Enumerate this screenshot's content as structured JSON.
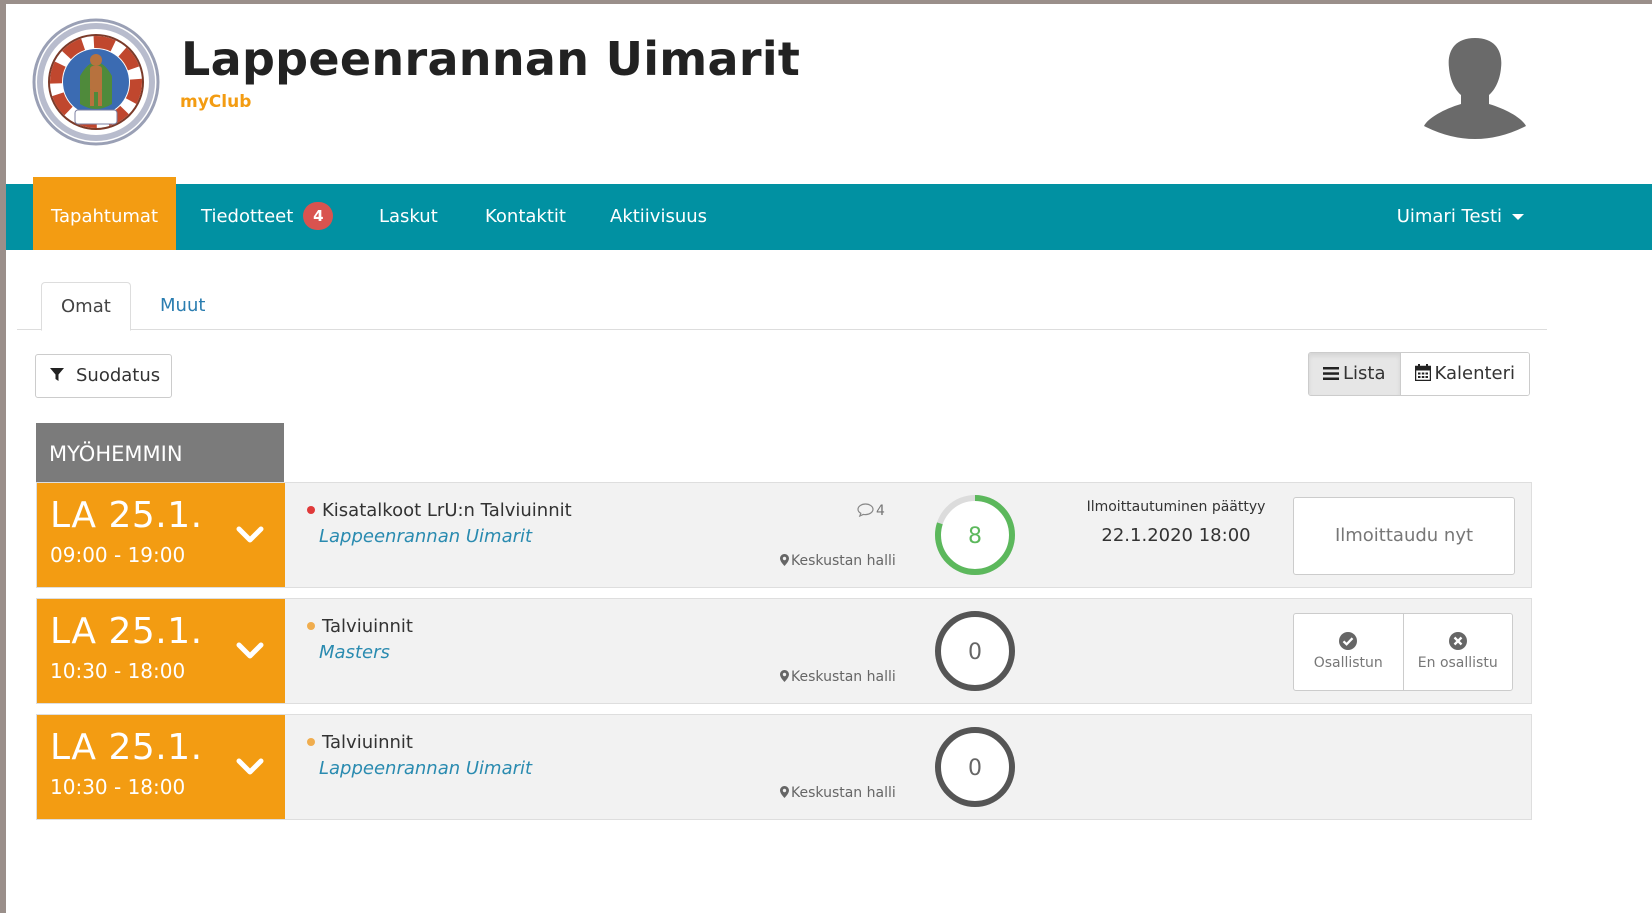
{
  "header": {
    "club_name": "Lappeenrannan Uimarit",
    "subtitle": "myClub",
    "logo_icon": "club-logo-icon",
    "avatar_icon": "user-silhouette-icon"
  },
  "nav": {
    "items": [
      {
        "label": "Tapahtumat",
        "active": true
      },
      {
        "label": "Tiedotteet",
        "badge": "4"
      },
      {
        "label": "Laskut"
      },
      {
        "label": "Kontaktit"
      },
      {
        "label": "Aktiivisuus"
      }
    ],
    "user": "Uimari Testi"
  },
  "tabs": [
    "Omat",
    "Muut"
  ],
  "toolbar": {
    "filter_label": "Suodatus",
    "view_list": "Lista",
    "view_calendar": "Kalenteri"
  },
  "section_label": "MYÖHEMMIN",
  "events": [
    {
      "day": "LA 25.1.",
      "time": "09:00 - 19:00",
      "title": "Kisatalkoot LrU:n Talviuinnit",
      "dot_color": "#e03a3a",
      "organizer": "Lappeenrannan Uimarit",
      "comments": "4",
      "location": "Keskustan halli",
      "participants": "8",
      "ring_fill": 0.8,
      "registration_label": "Ilmoittautuminen päättyy",
      "registration_date": "22.1.2020 18:00",
      "signup": "Ilmoittaudu nyt"
    },
    {
      "day": "LA 25.1.",
      "time": "10:30 - 18:00",
      "title": "Talviuinnit",
      "dot_color": "#f0ad4e",
      "organizer": "Masters",
      "location": "Keskustan halli",
      "participants": "0",
      "ring_fill": 0,
      "attend": "Osallistun",
      "decline": "En osallistu"
    },
    {
      "day": "LA 25.1.",
      "time": "10:30 - 18:00",
      "title": "Talviuinnit",
      "dot_color": "#f0ad4e",
      "organizer": "Lappeenrannan Uimarit",
      "location": "Keskustan halli",
      "participants": "0",
      "ring_fill": 0
    }
  ],
  "colors": {
    "brand_teal": "#0191a2",
    "accent_orange": "#f39c12",
    "ring_green": "#5cb85c",
    "ring_grey": "#555555"
  }
}
